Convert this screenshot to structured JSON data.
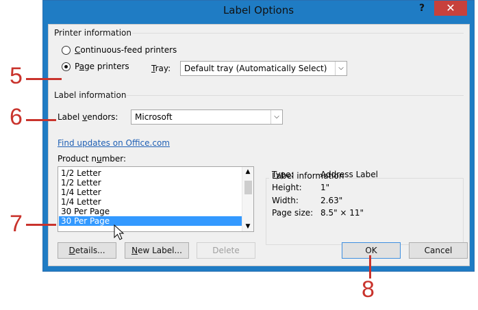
{
  "window": {
    "title": "Label Options",
    "help": "?",
    "close": "✕"
  },
  "printer_information": {
    "header": "Printer information",
    "continuous_label_u": "C",
    "continuous_label_rest": "ontinuous-feed printers",
    "page_label_pre": "P",
    "page_label_u": "a",
    "page_label_rest": "ge printers",
    "tray_label_u": "T",
    "tray_label_rest": "ray:",
    "tray_value": "Default tray (Automatically Select)"
  },
  "label_information": {
    "header": "Label information",
    "vendors_pre": "Label ",
    "vendors_u": "v",
    "vendors_rest": "endors:",
    "vendors_value": "Microsoft"
  },
  "find_updates_link": "Find updates on Office.com",
  "product_number": {
    "label_pre": "Product n",
    "label_u": "u",
    "label_rest": "mber:",
    "items": [
      "1/2 Letter",
      "1/2 Letter",
      "1/4 Letter",
      "1/4 Letter",
      "30 Per Page",
      "30 Per Page"
    ],
    "selected_index": 5
  },
  "label_details": {
    "header": "Label information",
    "rows": [
      {
        "key": "Type:",
        "value": "Address Label"
      },
      {
        "key": "Height:",
        "value": "1\""
      },
      {
        "key": "Width:",
        "value": "2.63\""
      },
      {
        "key": "Page size:",
        "value": "8.5\" × 11\""
      }
    ]
  },
  "buttons": {
    "details_u": "D",
    "details_rest": "etails...",
    "new_label_u": "N",
    "new_label_rest": "ew Label...",
    "delete": "Delete",
    "ok": "OK",
    "cancel": "Cancel"
  },
  "callouts": [
    "5",
    "6",
    "7",
    "8"
  ],
  "colors": {
    "title_bar": "#1f7cc4",
    "close_button": "#c7413c",
    "selection": "#3399ff",
    "callout": "#c9332c",
    "link": "#1e5fb4"
  }
}
